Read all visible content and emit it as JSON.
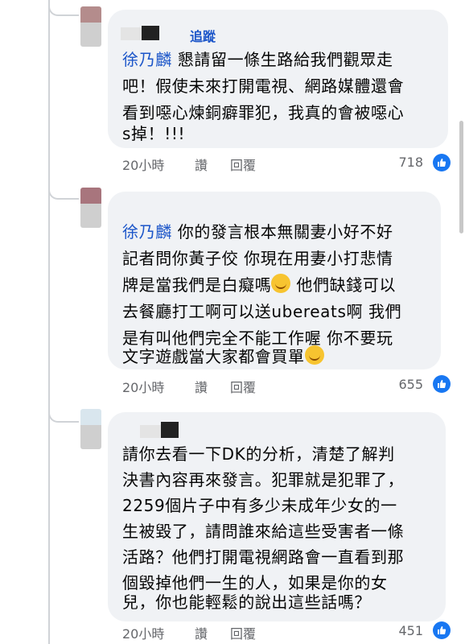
{
  "comments": [
    {
      "follow_label": "追蹤",
      "mention": "徐乃麟",
      "lines": [
        "懇請留一條生路給我們觀眾走",
        "吧！假使未來打開電視、網路媒體還會",
        "看到噁心煉銅癖罪犯，我真的會被噁心",
        "s掉！!!!"
      ],
      "time": "20小時",
      "like_label": "讚",
      "reply_label": "回覆",
      "reactions": "718",
      "avatar_color": "#b48c8c"
    },
    {
      "mention": "徐乃麟",
      "lines": [
        "你的發言根本無關妻小好不好",
        "記者問你黃子佼 你現在用妻小打悲情",
        "牌是當我們是白癡嗎",
        "去餐廳打工啊可以送ubereats啊 我們",
        "是有叫他們完全不能工作喔 你不要玩",
        "文字遊戲當大家都會買單"
      ],
      "line3_tail": "他們缺錢可以",
      "time": "20小時",
      "like_label": "讚",
      "reply_label": "回覆",
      "reactions": "655",
      "avatar_color": "#a8757d"
    },
    {
      "lines": [
        "請你去看一下DK的分析，清楚了解判",
        "決書內容再來發言。犯罪就是犯罪了，",
        "2259個片子中有多少未成年少女的一",
        "生被毀了，請問誰來給這些受害者一條",
        "活路？他們打開電視網路會一直看到那",
        "個毀掉他們一生的人，如果是你的女",
        "兒，你也能輕鬆的說出這些話嗎？"
      ],
      "time": "20小時",
      "like_label": "讚",
      "reply_label": "回覆",
      "reactions": "451",
      "avatar_color": "#d9e6ee"
    }
  ],
  "icons": {
    "like": "thumbs-up-icon",
    "emoji_laugh": "tears-of-joy-emoji",
    "emoji_grin": "grinning-emoji"
  }
}
